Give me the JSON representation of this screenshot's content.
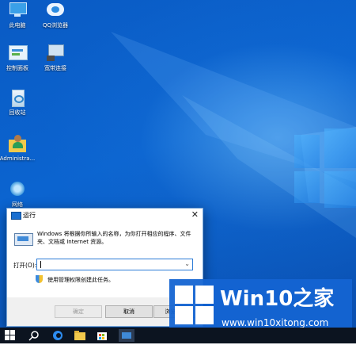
{
  "desktop": {
    "icons": [
      {
        "label": "此电脑",
        "icon": "computer-icon"
      },
      {
        "label": "QQ浏览器",
        "icon": "qq-browser-icon"
      },
      {
        "label": "控制面板",
        "icon": "control-panel-icon"
      },
      {
        "label": "宽带连接",
        "icon": "broadband-icon"
      },
      {
        "label": "回收站",
        "icon": "recycle-bin-icon"
      },
      {
        "label": "Administra...",
        "icon": "user-folder-icon"
      },
      {
        "label": "网络",
        "icon": "network-icon"
      }
    ]
  },
  "run_dialog": {
    "title": "运行",
    "description": "Windows 将根据你所输入的名称，为你打开相应的程序、文件夹、文档或 Internet 资源。",
    "open_label": "打开(O):",
    "open_value": "",
    "admin_text": "使用管理权限创建此任务。",
    "ok_label": "确定",
    "cancel_label": "取消",
    "browse_label": "浏览(B)..."
  },
  "watermark": {
    "brand": "Win10",
    "brand_zh": "之家",
    "url": "www.win10xitong.com"
  },
  "colors": {
    "desktop": "#0b64d0",
    "accent": "#2c7bd6",
    "taskbar": "#0c1420"
  }
}
